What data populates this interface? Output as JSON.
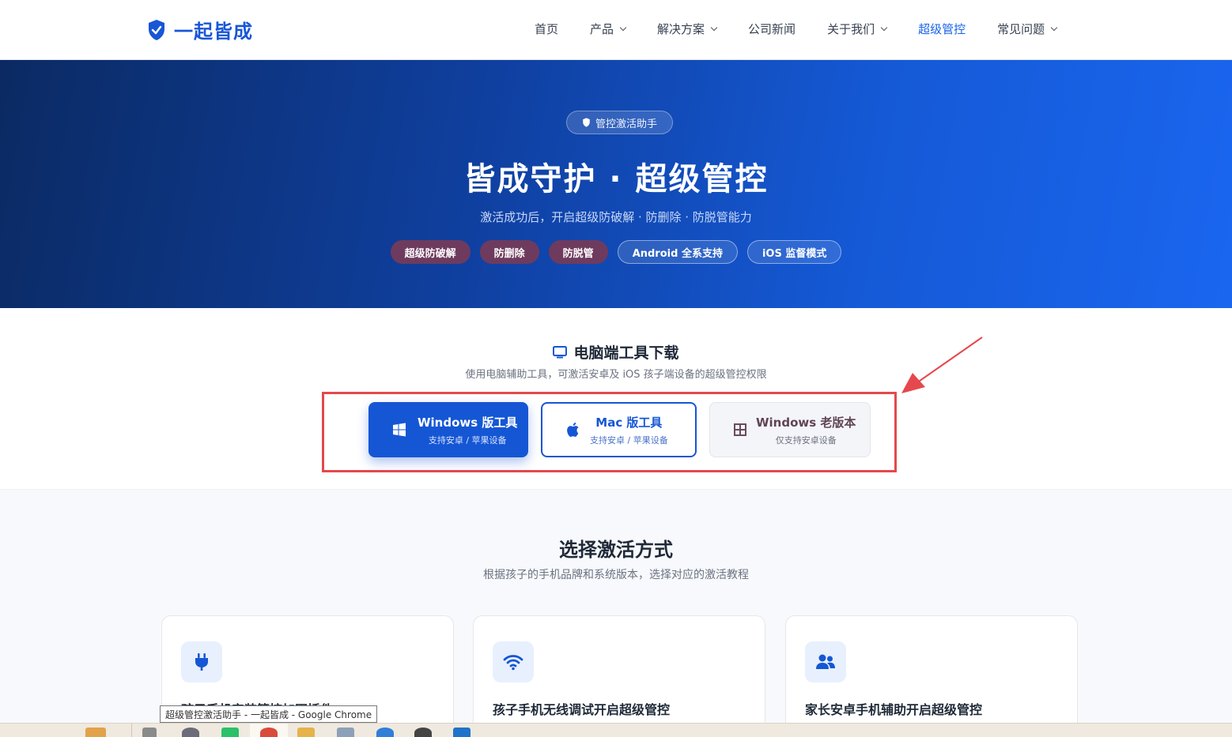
{
  "header": {
    "logo_text": "一起皆成",
    "nav": [
      {
        "label": "首页",
        "dropdown": false,
        "active": false
      },
      {
        "label": "产品",
        "dropdown": true,
        "active": false
      },
      {
        "label": "解决方案",
        "dropdown": true,
        "active": false
      },
      {
        "label": "公司新闻",
        "dropdown": false,
        "active": false
      },
      {
        "label": "关于我们",
        "dropdown": true,
        "active": false
      },
      {
        "label": "超级管控",
        "dropdown": false,
        "active": true
      },
      {
        "label": "常见问题",
        "dropdown": true,
        "active": false
      }
    ]
  },
  "hero": {
    "badge": "管控激活助手",
    "title": "皆成守护 · 超级管控",
    "subtitle": "激活成功后，开启超级防破解 · 防删除 · 防脱管能力",
    "tags": [
      {
        "label": "超级防破解",
        "style": "warm"
      },
      {
        "label": "防删除",
        "style": "warm"
      },
      {
        "label": "防脱管",
        "style": "warm"
      },
      {
        "label": "Android 全系支持",
        "style": "cool"
      },
      {
        "label": "iOS 监督模式",
        "style": "cool"
      }
    ]
  },
  "download": {
    "title": "电脑端工具下载",
    "subtitle": "使用电脑辅助工具，可激活安卓及 iOS 孩子端设备的超级管控权限",
    "buttons": {
      "windows": {
        "title": "Windows 版工具",
        "desc": "支持安卓 / 苹果设备",
        "icon": "windows-icon"
      },
      "mac": {
        "title": "Mac 版工具",
        "desc": "支持安卓 / 苹果设备",
        "icon": "apple-icon"
      },
      "windows_old": {
        "title": "Windows 老版本",
        "desc": "仅支持安卓设备",
        "icon": "windows-old-icon"
      }
    }
  },
  "activation": {
    "title": "选择激活方式",
    "subtitle": "根据孩子的手机品牌和系统版本，选择对应的激活教程",
    "cards": [
      {
        "title": "孩子手机安装管控加固插件",
        "icon": "plug-icon"
      },
      {
        "title": "孩子手机无线调试开启超级管控",
        "icon": "wifi-icon"
      },
      {
        "title": "家长安卓手机辅助开启超级管控",
        "icon": "users-icon"
      }
    ]
  },
  "tooltip": "超级管控激活助手 - 一起皆成 - Google Chrome",
  "colors": {
    "brand": "#1856d6",
    "accent_active": "#1a64e8",
    "highlight": "#e5484d",
    "tag_warm": "#6e3b5e"
  }
}
